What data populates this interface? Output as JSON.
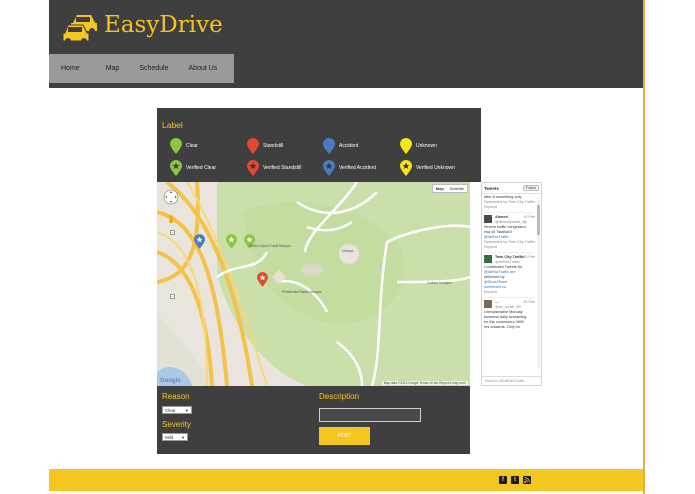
{
  "brand": {
    "name": "EasyDrive",
    "accent": "#f3c623",
    "dark": "#3f3f3f"
  },
  "nav": {
    "items": [
      "Home",
      "Map",
      "Schedule",
      "About Us"
    ]
  },
  "legend": {
    "title": "Label",
    "items": [
      {
        "label": "Clear",
        "color": "#8cc63f",
        "icon": "pin-icon"
      },
      {
        "label": "Standstill",
        "color": "#e2492f",
        "icon": "pin-icon"
      },
      {
        "label": "Accident",
        "color": "#4a7dbf",
        "icon": "pin-icon"
      },
      {
        "label": "Unknown",
        "color": "#f5e61a",
        "icon": "pin-icon"
      },
      {
        "label": "Verified Clear",
        "color": "#8cc63f",
        "icon": "star-pin-icon"
      },
      {
        "label": "Verified Standstill",
        "color": "#e2492f",
        "icon": "star-pin-icon"
      },
      {
        "label": "Verified Accident",
        "color": "#4a7dbf",
        "icon": "star-pin-icon"
      },
      {
        "label": "Verified Unknown",
        "color": "#f5e61a",
        "icon": "star-pin-icon"
      }
    ]
  },
  "map": {
    "type_buttons": [
      "Map",
      "Satellite"
    ],
    "footer": "Map data ©2015 Google   Terms of Use   Report a map error",
    "google": "Google",
    "place_labels": [
      "Mosque",
      "Cultural Complex",
      "Sheikh Zayed Grand Mosque",
      "Presidential Palace Mosque"
    ]
  },
  "tweets": {
    "title": "Tweets",
    "follow": "Follow",
    "entries": [
      {
        "text": [
          "after 8.something only",
          "Retweeted by Twin City Traffic",
          "Expand"
        ]
      },
      {
        "name": "Ahmed",
        "handle": "@ahmadpradit_ajb",
        "date": "19 Feb",
        "text": [
          "Severe traffic congestion",
          "esq 44 TalaBaGi",
          "@IdiRazTraffic",
          "Retweeted by Twin City Traffic",
          "Expand"
        ]
      },
      {
        "name": "Twin City Traffic",
        "handle": "@IdiRazTraffic",
        "date": "19 Feb",
        "text": [
          "Contributed Tweets for",
          "@IdiRazTraffic are",
          "delivered by",
          "@StreetTeam",
          "mentfeam.co",
          "Expand"
        ]
      },
      {
        "name": "...",
        "handle": "@uri_mukti_99",
        "date": "19 Feb",
        "text": [
          "Unexplainable Monday",
          "business daily screaming",
          "for the commuters 0800",
          "hrs onwards. Only on"
        ]
      }
    ],
    "footer": "Tweet to @IdiRazTraffic"
  },
  "form": {
    "reason_label": "Reason",
    "reason_value": "Clear",
    "severity_label": "Severity",
    "severity_value": "Mild",
    "description_label": "Description",
    "description_value": "",
    "post_label": "POST"
  },
  "footer": {
    "social": [
      "f",
      "t",
      "rss"
    ]
  }
}
